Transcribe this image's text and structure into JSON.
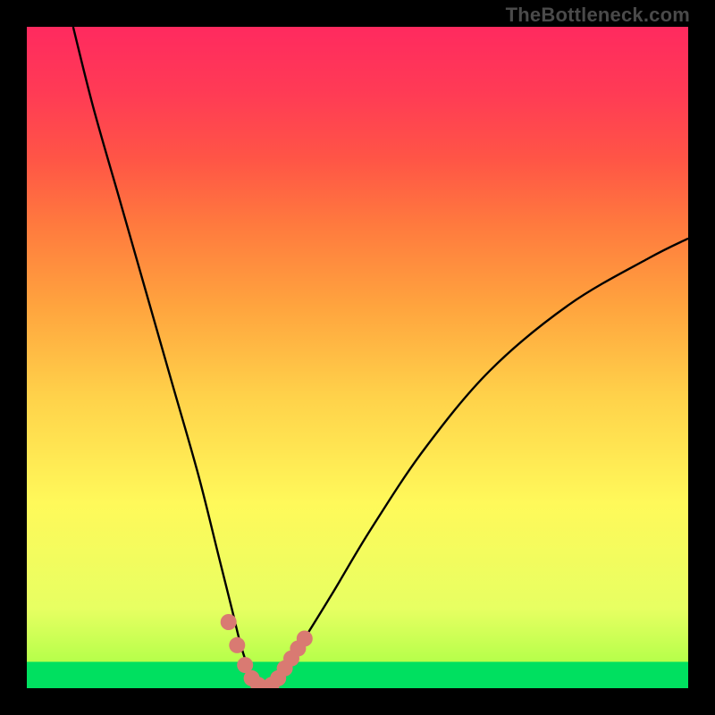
{
  "watermark": {
    "text": "TheBottleneck.com"
  },
  "colors": {
    "background": "#000000",
    "curve_stroke": "#000000",
    "marker_fill": "#d97a72",
    "gradient_top": "#ff2a5f",
    "gradient_mid": "#fff95a",
    "gradient_green": "#00e060"
  },
  "chart_data": {
    "type": "line",
    "title": "",
    "xlabel": "",
    "ylabel": "",
    "xlim": [
      0,
      100
    ],
    "ylim": [
      0,
      100
    ],
    "series": [
      {
        "name": "bottleneck-curve",
        "x": [
          7,
          10,
          14,
          18,
          22,
          26,
          29,
          31,
          32.5,
          34,
          36,
          38,
          41,
          46,
          52,
          60,
          70,
          82,
          94,
          100
        ],
        "values": [
          100,
          88,
          74,
          60,
          46,
          32,
          20,
          12,
          6,
          2,
          0,
          2,
          6,
          14,
          24,
          36,
          48,
          58,
          65,
          68
        ]
      }
    ],
    "markers": {
      "name": "highlighted-points",
      "x": [
        30.5,
        31.8,
        33.0,
        34.0,
        35.0,
        36.0,
        37.0,
        38.0,
        39.0,
        40.0,
        41.0,
        42.0
      ],
      "values": [
        10.0,
        6.5,
        3.5,
        1.5,
        0.5,
        0.0,
        0.5,
        1.5,
        3.0,
        4.5,
        6.0,
        7.5
      ]
    }
  }
}
